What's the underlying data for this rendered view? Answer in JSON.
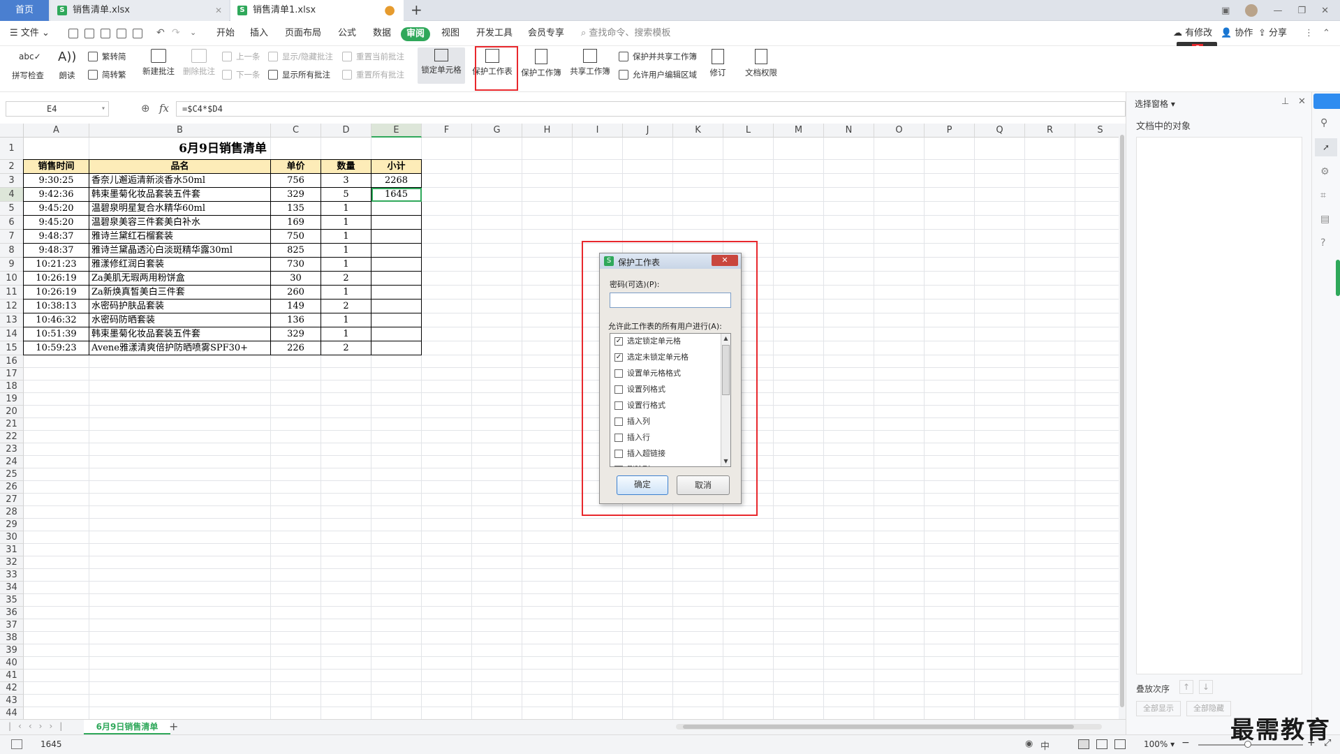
{
  "tabs": {
    "home": "首页",
    "file1": "销售清单.xlsx",
    "file2": "销售清单1.xlsx"
  },
  "menu": {
    "file": "文件",
    "items": [
      "开始",
      "插入",
      "页面布局",
      "公式",
      "数据",
      "审阅",
      "视图",
      "开发工具",
      "会员专享"
    ],
    "search_placeholder": "查找命令、搜索模板",
    "modified": "有修改",
    "collab": "协作",
    "share": "分享"
  },
  "ribbon": {
    "spell": "拼写检查",
    "read": "朗读",
    "trad": "繁转简",
    "simp": "简转繁",
    "new_comment": "新建批注",
    "delete_comment": "删除批注",
    "prev": "上一条",
    "next": "下一条",
    "show_hide": "显示/隐藏批注",
    "show_all": "显示所有批注",
    "reset_current": "重置当前批注",
    "reset_all": "重置所有批注",
    "lock_cell": "锁定单元格",
    "protect_sheet": "保护工作表",
    "protect_book": "保护工作簿",
    "share_book": "共享工作簿",
    "protect_share": "保护并共享工作簿",
    "allow_edit": "允许用户编辑区域",
    "revise": "修订",
    "doc_rights": "文档权限"
  },
  "formula": {
    "cell_ref": "E4",
    "fx": "fx",
    "value": "=$C4*$D4"
  },
  "columns": [
    "A",
    "B",
    "C",
    "D",
    "E",
    "F",
    "G",
    "H",
    "I",
    "J",
    "K",
    "L",
    "M",
    "N",
    "O",
    "P",
    "Q",
    "R",
    "S"
  ],
  "rows": [
    "1",
    "2",
    "3",
    "4",
    "5",
    "6",
    "7",
    "8",
    "9",
    "10",
    "11",
    "12",
    "13",
    "14",
    "15",
    "16",
    "17",
    "18",
    "19",
    "20",
    "21",
    "22",
    "23",
    "24",
    "25",
    "26",
    "27",
    "28",
    "29",
    "30",
    "31",
    "32",
    "33",
    "34",
    "35",
    "36",
    "37",
    "38",
    "39",
    "40",
    "41",
    "42",
    "43",
    "44"
  ],
  "table": {
    "title": "6月9日销售清单",
    "headers": [
      "销售时间",
      "品名",
      "单价",
      "数量",
      "小计"
    ],
    "data": [
      [
        "9:30:25",
        "香奈儿邂逅清新淡香水50ml",
        "756",
        "3",
        "2268"
      ],
      [
        "9:42:36",
        "韩束墨菊化妆品套装五件套",
        "329",
        "5",
        "1645"
      ],
      [
        "9:45:20",
        "温碧泉明星复合水精华60ml",
        "135",
        "1",
        ""
      ],
      [
        "9:45:20",
        "温碧泉美容三件套美白补水",
        "169",
        "1",
        ""
      ],
      [
        "9:48:37",
        "雅诗兰黛红石榴套装",
        "750",
        "1",
        ""
      ],
      [
        "9:48:37",
        "雅诗兰黛晶透沁白淡斑精华露30ml",
        "825",
        "1",
        ""
      ],
      [
        "10:21:23",
        "雅漾修红润白套装",
        "730",
        "1",
        ""
      ],
      [
        "10:26:19",
        "Za美肌无瑕两用粉饼盒",
        "30",
        "2",
        ""
      ],
      [
        "10:26:19",
        "Za新焕真皙美白三件套",
        "260",
        "1",
        ""
      ],
      [
        "10:38:13",
        "水密码护肤品套装",
        "149",
        "2",
        ""
      ],
      [
        "10:46:32",
        "水密码防晒套装",
        "136",
        "1",
        ""
      ],
      [
        "10:51:39",
        "韩束墨菊化妆品套装五件套",
        "329",
        "1",
        ""
      ],
      [
        "10:59:23",
        "Avene雅漾清爽倍护防晒喷雾SPF30+",
        "226",
        "2",
        ""
      ]
    ]
  },
  "dialog": {
    "title": "保护工作表",
    "password_label": "密码(可选)(P):",
    "allow_label": "允许此工作表的所有用户进行(A):",
    "options": [
      {
        "label": "选定锁定单元格",
        "checked": true
      },
      {
        "label": "选定未锁定单元格",
        "checked": true
      },
      {
        "label": "设置单元格格式",
        "checked": false
      },
      {
        "label": "设置列格式",
        "checked": false
      },
      {
        "label": "设置行格式",
        "checked": false
      },
      {
        "label": "插入列",
        "checked": false
      },
      {
        "label": "插入行",
        "checked": false
      },
      {
        "label": "插入超链接",
        "checked": false
      },
      {
        "label": "删除列",
        "checked": false
      }
    ],
    "ok": "确定",
    "cancel": "取消"
  },
  "pane": {
    "title": "选择窗格",
    "objects": "文档中的对象",
    "order": "叠放次序",
    "show_all": "全部显示",
    "hide_all": "全部隐藏"
  },
  "sheet_tab": "6月9日销售清单",
  "status": {
    "value": "1645",
    "zoom": "100%"
  },
  "watermark": "最需教育"
}
